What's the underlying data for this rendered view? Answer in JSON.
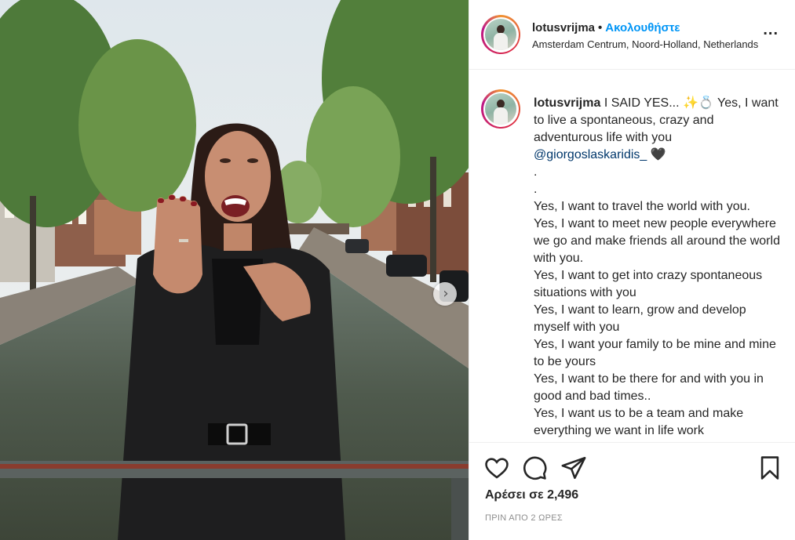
{
  "post": {
    "username": "lotusvrijma",
    "separator": "•",
    "follow_label": "Ακολουθήστε",
    "location": "Amsterdam Centrum, Noord-Holland, Netherlands",
    "more_label": "...",
    "caption_username": "lotusvrijma",
    "caption_first": "I SAID YES... ✨💍 Yes, I want to live a spontaneous, crazy and adventurous life with you",
    "mention": "@giorgoslaskaridis_",
    "heart": "🖤",
    "caption_lines": [
      ".",
      ".",
      "Yes, I want to travel the world with you.",
      "Yes, I want to meet new people everywhere we go and make friends all around the world with you.",
      "Yes, I want to get into crazy spontaneous situations with you",
      "Yes, I want to learn, grow and develop myself with you",
      "Yes, I want your family to be mine and mine to be yours",
      "Yes, I want to be there for and with you in good and bad times..",
      "Yes, I want us to be a team and make everything we want in life work"
    ],
    "likes_text": "Αρέσει σε 2,496",
    "time_text": "ΠΡΙΝ ΑΠΟ 2 ΩΡΕΣ",
    "next_arrow": "›"
  },
  "icons": {
    "like": "heart-icon",
    "comment": "comment-icon",
    "share": "share-icon",
    "save": "bookmark-icon",
    "next": "chevron-right-icon"
  },
  "colors": {
    "follow": "#0095f6",
    "text": "#262626",
    "muted": "#8e8e8e",
    "border": "#efefef"
  }
}
